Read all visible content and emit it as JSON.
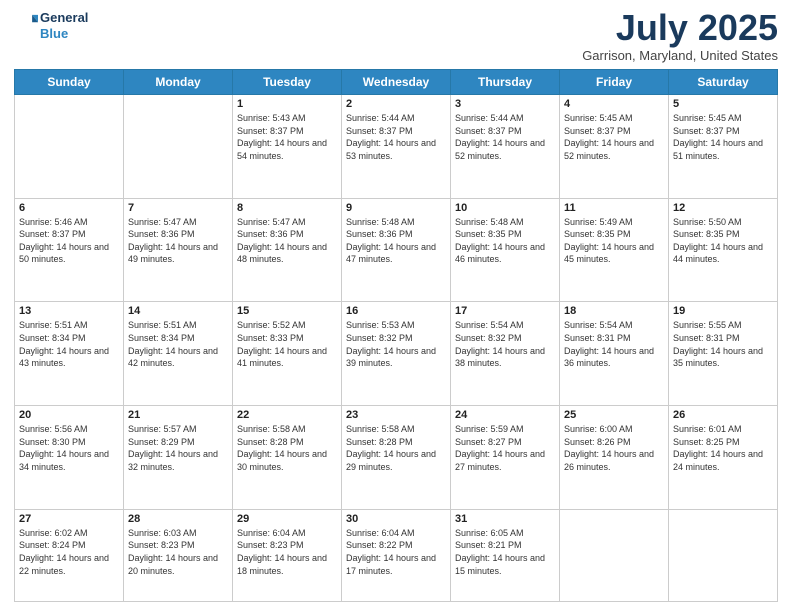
{
  "header": {
    "logo_line1": "General",
    "logo_line2": "Blue",
    "month": "July 2025",
    "location": "Garrison, Maryland, United States"
  },
  "weekdays": [
    "Sunday",
    "Monday",
    "Tuesday",
    "Wednesday",
    "Thursday",
    "Friday",
    "Saturday"
  ],
  "weeks": [
    [
      {
        "day": "",
        "sunrise": "",
        "sunset": "",
        "daylight": ""
      },
      {
        "day": "",
        "sunrise": "",
        "sunset": "",
        "daylight": ""
      },
      {
        "day": "1",
        "sunrise": "Sunrise: 5:43 AM",
        "sunset": "Sunset: 8:37 PM",
        "daylight": "Daylight: 14 hours and 54 minutes."
      },
      {
        "day": "2",
        "sunrise": "Sunrise: 5:44 AM",
        "sunset": "Sunset: 8:37 PM",
        "daylight": "Daylight: 14 hours and 53 minutes."
      },
      {
        "day": "3",
        "sunrise": "Sunrise: 5:44 AM",
        "sunset": "Sunset: 8:37 PM",
        "daylight": "Daylight: 14 hours and 52 minutes."
      },
      {
        "day": "4",
        "sunrise": "Sunrise: 5:45 AM",
        "sunset": "Sunset: 8:37 PM",
        "daylight": "Daylight: 14 hours and 52 minutes."
      },
      {
        "day": "5",
        "sunrise": "Sunrise: 5:45 AM",
        "sunset": "Sunset: 8:37 PM",
        "daylight": "Daylight: 14 hours and 51 minutes."
      }
    ],
    [
      {
        "day": "6",
        "sunrise": "Sunrise: 5:46 AM",
        "sunset": "Sunset: 8:37 PM",
        "daylight": "Daylight: 14 hours and 50 minutes."
      },
      {
        "day": "7",
        "sunrise": "Sunrise: 5:47 AM",
        "sunset": "Sunset: 8:36 PM",
        "daylight": "Daylight: 14 hours and 49 minutes."
      },
      {
        "day": "8",
        "sunrise": "Sunrise: 5:47 AM",
        "sunset": "Sunset: 8:36 PM",
        "daylight": "Daylight: 14 hours and 48 minutes."
      },
      {
        "day": "9",
        "sunrise": "Sunrise: 5:48 AM",
        "sunset": "Sunset: 8:36 PM",
        "daylight": "Daylight: 14 hours and 47 minutes."
      },
      {
        "day": "10",
        "sunrise": "Sunrise: 5:48 AM",
        "sunset": "Sunset: 8:35 PM",
        "daylight": "Daylight: 14 hours and 46 minutes."
      },
      {
        "day": "11",
        "sunrise": "Sunrise: 5:49 AM",
        "sunset": "Sunset: 8:35 PM",
        "daylight": "Daylight: 14 hours and 45 minutes."
      },
      {
        "day": "12",
        "sunrise": "Sunrise: 5:50 AM",
        "sunset": "Sunset: 8:35 PM",
        "daylight": "Daylight: 14 hours and 44 minutes."
      }
    ],
    [
      {
        "day": "13",
        "sunrise": "Sunrise: 5:51 AM",
        "sunset": "Sunset: 8:34 PM",
        "daylight": "Daylight: 14 hours and 43 minutes."
      },
      {
        "day": "14",
        "sunrise": "Sunrise: 5:51 AM",
        "sunset": "Sunset: 8:34 PM",
        "daylight": "Daylight: 14 hours and 42 minutes."
      },
      {
        "day": "15",
        "sunrise": "Sunrise: 5:52 AM",
        "sunset": "Sunset: 8:33 PM",
        "daylight": "Daylight: 14 hours and 41 minutes."
      },
      {
        "day": "16",
        "sunrise": "Sunrise: 5:53 AM",
        "sunset": "Sunset: 8:32 PM",
        "daylight": "Daylight: 14 hours and 39 minutes."
      },
      {
        "day": "17",
        "sunrise": "Sunrise: 5:54 AM",
        "sunset": "Sunset: 8:32 PM",
        "daylight": "Daylight: 14 hours and 38 minutes."
      },
      {
        "day": "18",
        "sunrise": "Sunrise: 5:54 AM",
        "sunset": "Sunset: 8:31 PM",
        "daylight": "Daylight: 14 hours and 36 minutes."
      },
      {
        "day": "19",
        "sunrise": "Sunrise: 5:55 AM",
        "sunset": "Sunset: 8:31 PM",
        "daylight": "Daylight: 14 hours and 35 minutes."
      }
    ],
    [
      {
        "day": "20",
        "sunrise": "Sunrise: 5:56 AM",
        "sunset": "Sunset: 8:30 PM",
        "daylight": "Daylight: 14 hours and 34 minutes."
      },
      {
        "day": "21",
        "sunrise": "Sunrise: 5:57 AM",
        "sunset": "Sunset: 8:29 PM",
        "daylight": "Daylight: 14 hours and 32 minutes."
      },
      {
        "day": "22",
        "sunrise": "Sunrise: 5:58 AM",
        "sunset": "Sunset: 8:28 PM",
        "daylight": "Daylight: 14 hours and 30 minutes."
      },
      {
        "day": "23",
        "sunrise": "Sunrise: 5:58 AM",
        "sunset": "Sunset: 8:28 PM",
        "daylight": "Daylight: 14 hours and 29 minutes."
      },
      {
        "day": "24",
        "sunrise": "Sunrise: 5:59 AM",
        "sunset": "Sunset: 8:27 PM",
        "daylight": "Daylight: 14 hours and 27 minutes."
      },
      {
        "day": "25",
        "sunrise": "Sunrise: 6:00 AM",
        "sunset": "Sunset: 8:26 PM",
        "daylight": "Daylight: 14 hours and 26 minutes."
      },
      {
        "day": "26",
        "sunrise": "Sunrise: 6:01 AM",
        "sunset": "Sunset: 8:25 PM",
        "daylight": "Daylight: 14 hours and 24 minutes."
      }
    ],
    [
      {
        "day": "27",
        "sunrise": "Sunrise: 6:02 AM",
        "sunset": "Sunset: 8:24 PM",
        "daylight": "Daylight: 14 hours and 22 minutes."
      },
      {
        "day": "28",
        "sunrise": "Sunrise: 6:03 AM",
        "sunset": "Sunset: 8:23 PM",
        "daylight": "Daylight: 14 hours and 20 minutes."
      },
      {
        "day": "29",
        "sunrise": "Sunrise: 6:04 AM",
        "sunset": "Sunset: 8:23 PM",
        "daylight": "Daylight: 14 hours and 18 minutes."
      },
      {
        "day": "30",
        "sunrise": "Sunrise: 6:04 AM",
        "sunset": "Sunset: 8:22 PM",
        "daylight": "Daylight: 14 hours and 17 minutes."
      },
      {
        "day": "31",
        "sunrise": "Sunrise: 6:05 AM",
        "sunset": "Sunset: 8:21 PM",
        "daylight": "Daylight: 14 hours and 15 minutes."
      },
      {
        "day": "",
        "sunrise": "",
        "sunset": "",
        "daylight": ""
      },
      {
        "day": "",
        "sunrise": "",
        "sunset": "",
        "daylight": ""
      }
    ]
  ]
}
